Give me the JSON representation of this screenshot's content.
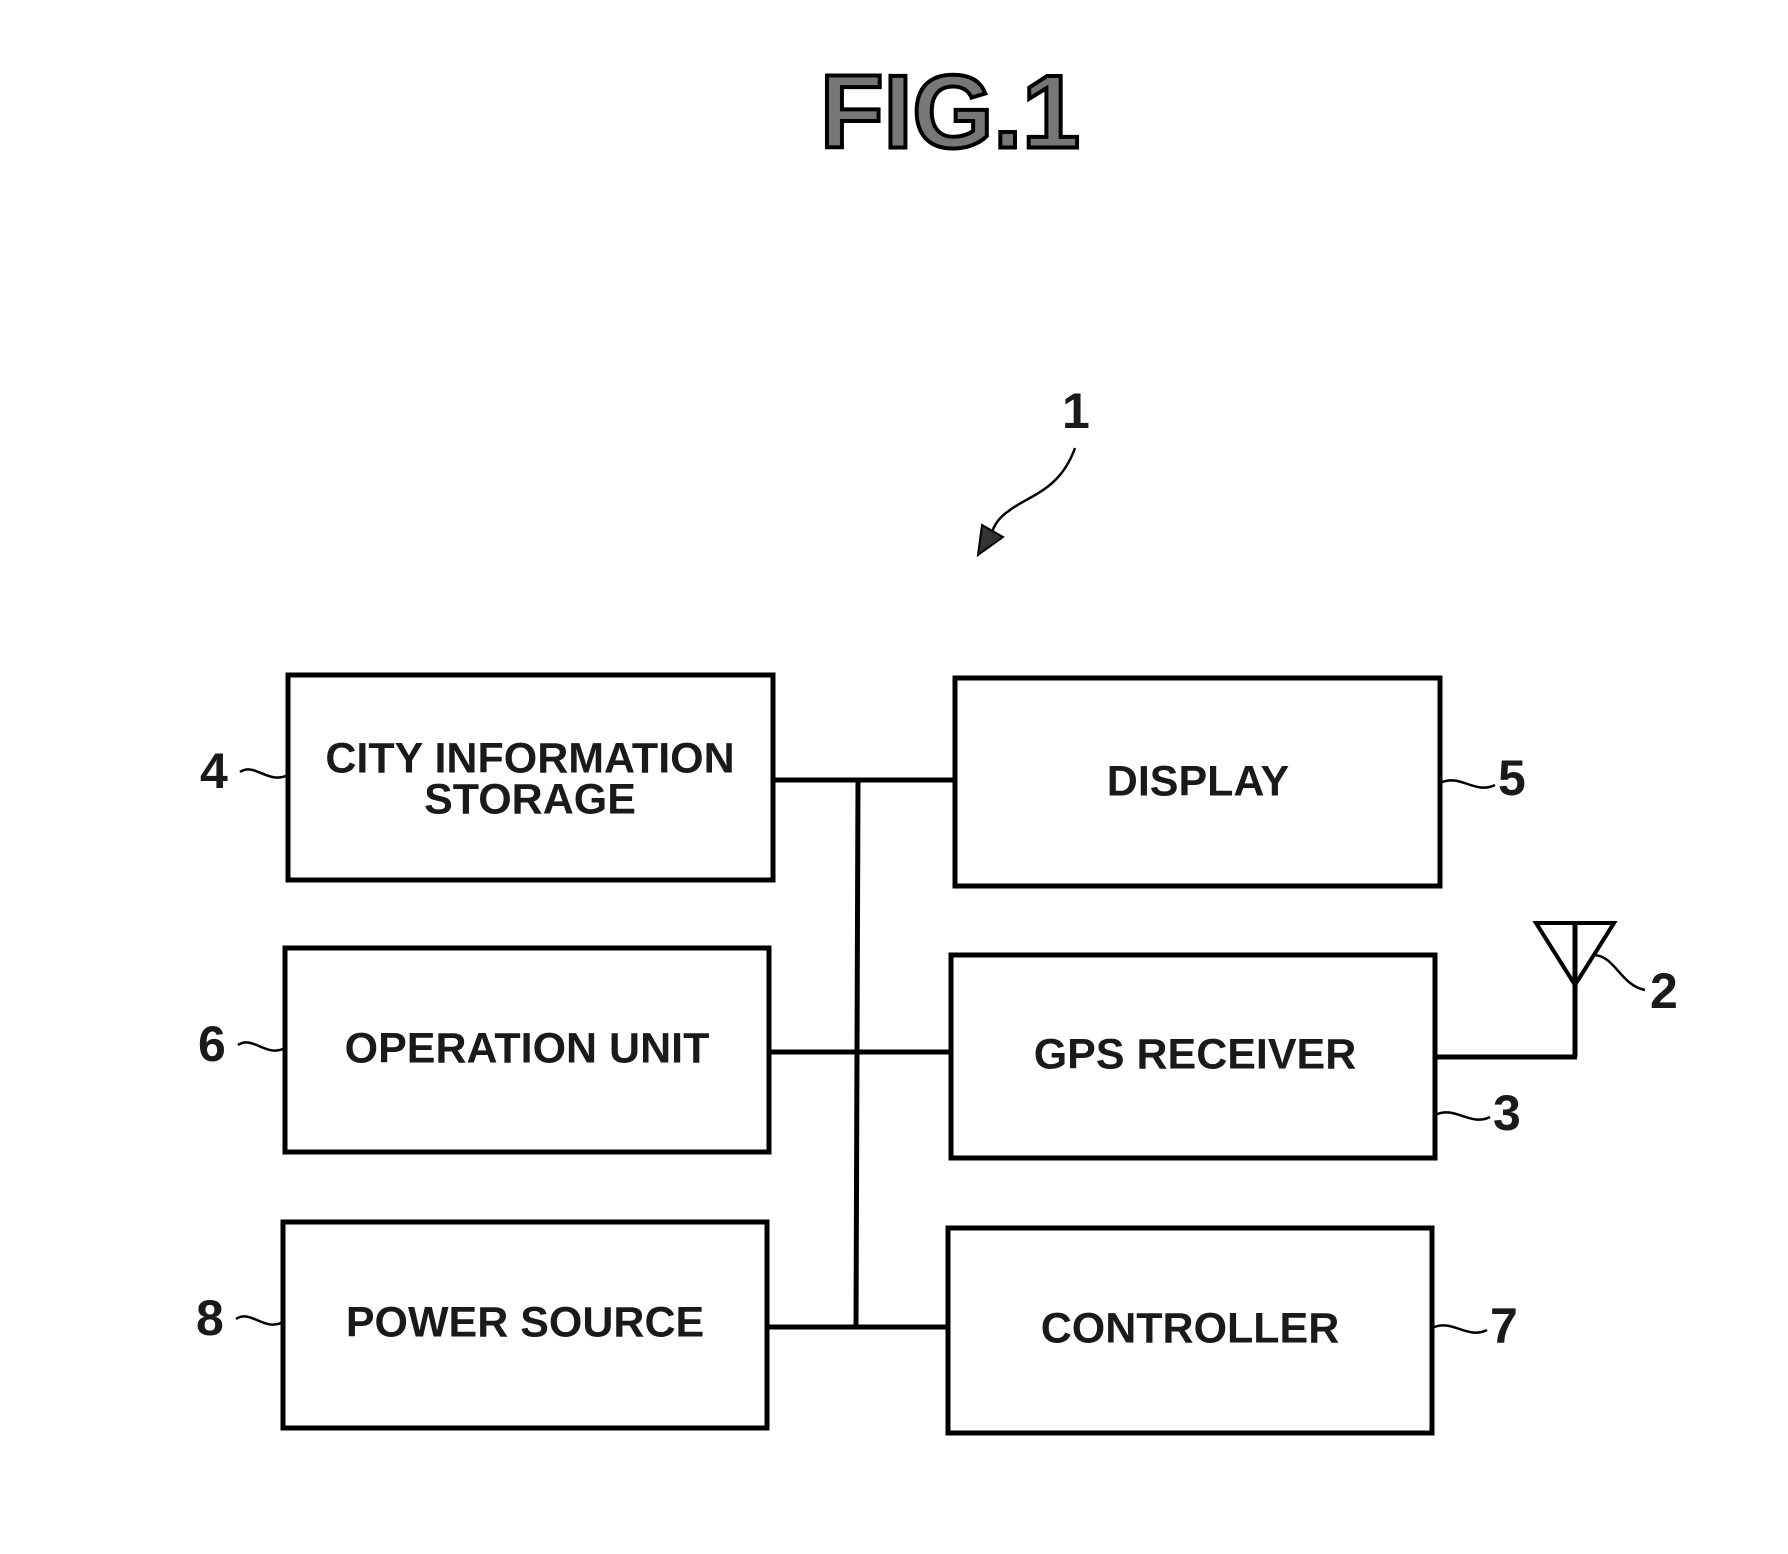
{
  "figure": {
    "title": "FIG.1",
    "device_ref": "1"
  },
  "blocks": {
    "city_information_storage": {
      "ref": "4",
      "label_line1": "CITY INFORMATION",
      "label_line2": "STORAGE"
    },
    "display": {
      "ref": "5",
      "label": "DISPLAY"
    },
    "operation_unit": {
      "ref": "6",
      "label": "OPERATION UNIT"
    },
    "gps_receiver": {
      "ref": "3",
      "label": "GPS RECEIVER"
    },
    "power_source": {
      "ref": "8",
      "label": "POWER SOURCE"
    },
    "controller": {
      "ref": "7",
      "label": "CONTROLLER"
    }
  },
  "antenna": {
    "ref": "2"
  },
  "connections": [
    {
      "from": "CITY INFORMATION STORAGE",
      "to": "bus"
    },
    {
      "from": "DISPLAY",
      "to": "bus"
    },
    {
      "from": "OPERATION UNIT",
      "to": "bus"
    },
    {
      "from": "GPS RECEIVER",
      "to": "bus"
    },
    {
      "from": "POWER SOURCE",
      "to": "bus"
    },
    {
      "from": "CONTROLLER",
      "to": "bus"
    },
    {
      "from": "GPS RECEIVER",
      "to": "antenna"
    }
  ]
}
